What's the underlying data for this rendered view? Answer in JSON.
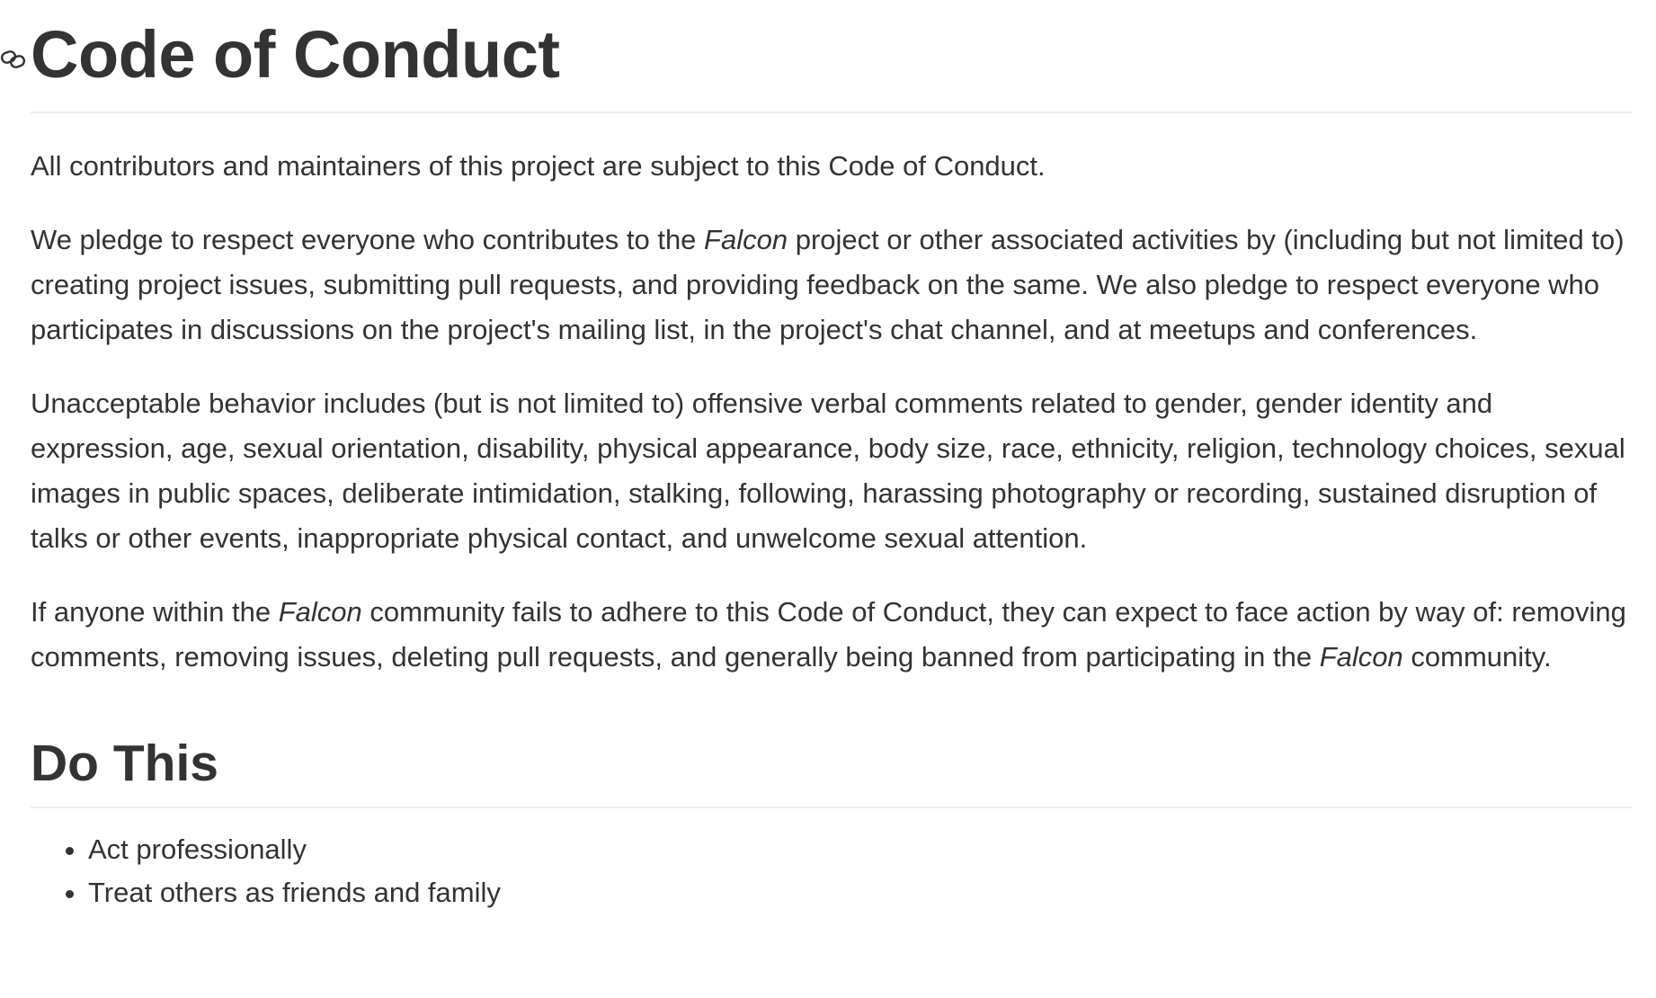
{
  "page": {
    "title": "Code of Conduct",
    "icons": {
      "anchor": "link-icon"
    },
    "colors": {
      "text": "#333333",
      "rule": "#eeeeee",
      "background": "#ffffff"
    },
    "intro": "All contributors and maintainers of this project are subject to this Code of Conduct.",
    "pledge": {
      "before": "We pledge to respect everyone who contributes to the ",
      "project": "Falcon",
      "after": " project or other associated activities by (including but not limited to) creating project issues, submitting pull requests, and providing feedback on the same. We also pledge to respect everyone who participates in discussions on the project's mailing list, in the project's chat channel, and at meetups and conferences."
    },
    "unacceptable": "Unacceptable behavior includes (but is not limited to) offensive verbal comments related to gender, gender identity and expression, age, sexual orientation, disability, physical appearance, body size, race, ethnicity, religion, technology choices, sexual images in public spaces, deliberate intimidation, stalking, following, harassing photography or recording, sustained disruption of talks or other events, inappropriate physical contact, and unwelcome sexual attention.",
    "enforcement": {
      "before": "If anyone within the ",
      "project1": "Falcon",
      "middle": " community fails to adhere to this Code of Conduct, they can expect to face action by way of: removing comments, removing issues, deleting pull requests, and generally being banned from participating in the ",
      "project2": "Falcon",
      "after": " community."
    },
    "do_this": {
      "heading": "Do This",
      "items": [
        "Act professionally",
        "Treat others as friends and family"
      ]
    }
  }
}
